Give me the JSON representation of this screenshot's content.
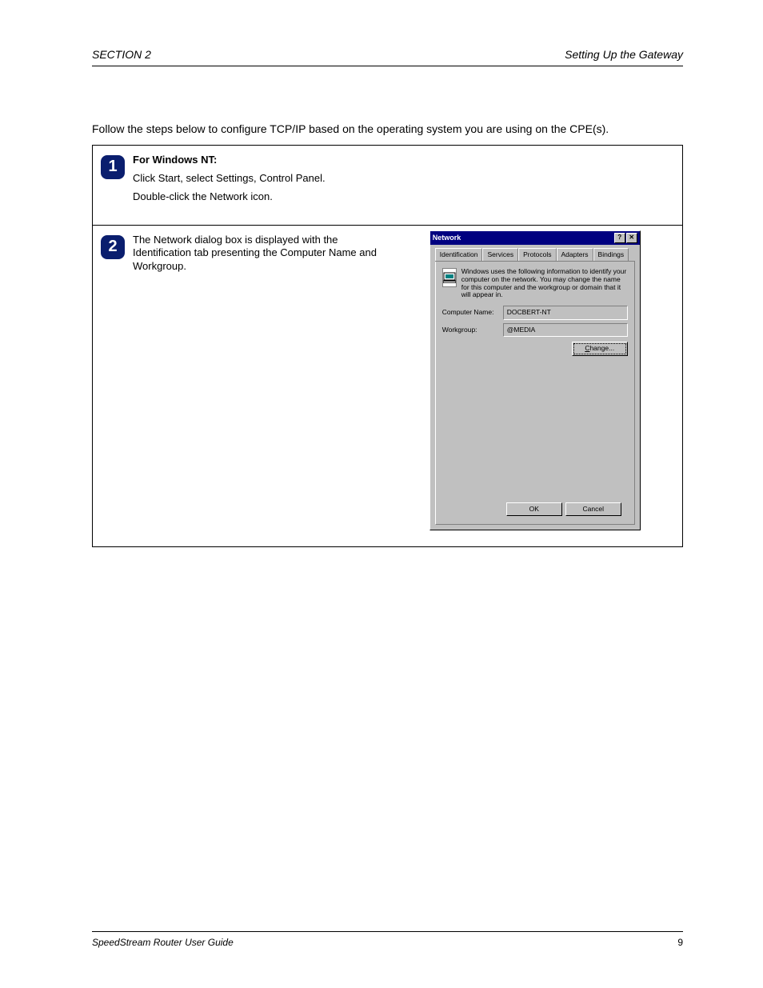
{
  "header": {
    "section": "SECTION 2",
    "title": "Setting Up the Gateway"
  },
  "intro": "Follow the steps below to configure TCP/IP based on the operating system you are using on the CPE(s).",
  "step1": {
    "num": "1",
    "heading": "For Windows NT:",
    "line1": "Click Start, select Settings, Control Panel.",
    "line2": "Double-click the Network icon."
  },
  "step2": {
    "num": "2",
    "text": "The Network dialog box is displayed with the Identification tab presenting the Computer Name and Workgroup."
  },
  "dialog": {
    "title": "Network",
    "help_icon": "?",
    "close_icon": "✕",
    "tabs": {
      "identification": "Identification",
      "services": "Services",
      "protocols": "Protocols",
      "adapters": "Adapters",
      "bindings": "Bindings"
    },
    "description": "Windows uses the following information to identify your computer on the network. You may change the name for this computer and the workgroup or domain that it will appear in.",
    "computer_name_label": "Computer Name:",
    "computer_name_value": "DOCBERT-NT",
    "workgroup_label": "Workgroup:",
    "workgroup_value": "@MEDIA",
    "change_btn": "Change...",
    "change_mnemonic": "C",
    "ok_btn": "OK",
    "cancel_btn": "Cancel"
  },
  "footer": {
    "book": "SpeedStream Router User Guide",
    "page": "9"
  }
}
